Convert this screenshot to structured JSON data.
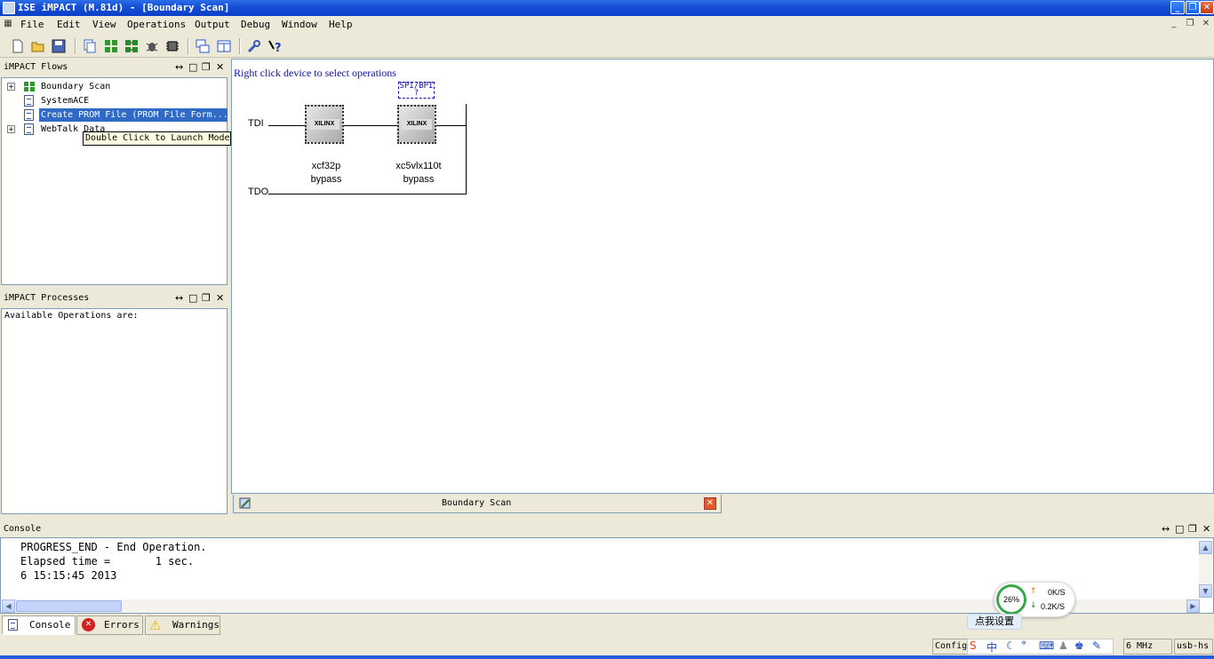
{
  "window": {
    "title": "ISE iMPACT (M.81d) - [Boundary Scan]"
  },
  "menu": [
    "File",
    "Edit",
    "View",
    "Operations",
    "Output",
    "Debug",
    "Window",
    "Help"
  ],
  "toolbar_icons": [
    "new-icon",
    "open-icon",
    "save-icon",
    "copy-icon",
    "grid-icon",
    "grid-alt-icon",
    "debug-icon",
    "chip-icon",
    "cascade-icon",
    "tile-icon",
    "wrench-icon",
    "help-icon"
  ],
  "flows_panel": {
    "title": "iMPACT Flows",
    "items": [
      {
        "label": "Boundary Scan",
        "expandable": true
      },
      {
        "label": "SystemACE",
        "expandable": false
      },
      {
        "label": "Create PROM File (PROM File Form...",
        "expandable": false,
        "selected": true
      },
      {
        "label": "WebTalk Data",
        "expandable": true
      }
    ],
    "tooltip": "Double Click to Launch Mode"
  },
  "processes_panel": {
    "title": "iMPACT Processes",
    "content": "Available Operations are:"
  },
  "canvas": {
    "hint": "Right click device to select operations",
    "tdi": "TDI",
    "tdo": "TDO",
    "spi_bpi": "SPI/BPI",
    "spi_q": "?",
    "devices": [
      {
        "name": "xcf32p",
        "mode": "bypass"
      },
      {
        "name": "xc5vlx110t",
        "mode": "bypass"
      }
    ],
    "chip_logo": "XILINX"
  },
  "doc_tab": {
    "label": "Boundary Scan"
  },
  "console": {
    "title": "Console",
    "lines": [
      "PROGRESS_END - End Operation.",
      "Elapsed time =       1 sec.",
      "6 15:15:45 2013"
    ]
  },
  "bottom_tabs": [
    {
      "label": "Console",
      "active": true
    },
    {
      "label": "Errors",
      "active": false
    },
    {
      "label": "Warnings",
      "active": false
    }
  ],
  "net_widget": {
    "percent": "26%",
    "up": "0K/S",
    "down": "0.2K/S",
    "settings": "点我设置"
  },
  "status": {
    "config": "Config",
    "speed": "6 MHz",
    "cable": "usb-hs"
  },
  "ime": {
    "lang": "中"
  }
}
